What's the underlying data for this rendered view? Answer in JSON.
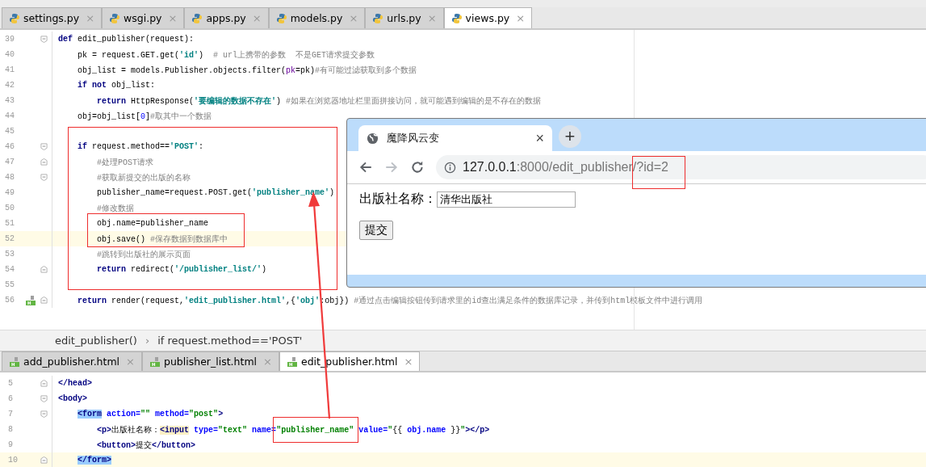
{
  "editor_tabs": [
    {
      "label": "settings.py",
      "close": "×",
      "selected": false
    },
    {
      "label": "wsgi.py",
      "close": "×",
      "selected": false
    },
    {
      "label": "apps.py",
      "close": "×",
      "selected": false
    },
    {
      "label": "models.py",
      "close": "×",
      "selected": false
    },
    {
      "label": "urls.py",
      "close": "×",
      "selected": false
    },
    {
      "label": "views.py",
      "close": "×",
      "selected": true
    }
  ],
  "python_editor": {
    "lines": [
      {
        "number": "39",
        "current": false,
        "fold_start": true,
        "fold_end": false,
        "tokens": [
          {
            "kind": "keyword",
            "text": "def"
          },
          {
            "kind": "plain",
            "text": " edit_publisher(request):"
          }
        ]
      },
      {
        "number": "40",
        "current": false,
        "fold_start": false,
        "fold_end": false,
        "tokens": [
          {
            "kind": "plain",
            "text": "    pk = request.GET.get("
          },
          {
            "kind": "string",
            "text": "'id'"
          },
          {
            "kind": "plain",
            "text": ")  "
          },
          {
            "kind": "comment",
            "text": "# url上携带的参数  不是GET请求提交参数"
          }
        ]
      },
      {
        "number": "41",
        "current": false,
        "fold_start": false,
        "fold_end": false,
        "tokens": [
          {
            "kind": "plain",
            "text": "    obj_list = models.Publisher.objects.filter("
          },
          {
            "kind": "param",
            "text": "pk"
          },
          {
            "kind": "plain",
            "text": "=pk)"
          },
          {
            "kind": "comment",
            "text": "#有可能过滤获取到多个数据"
          }
        ]
      },
      {
        "number": "42",
        "current": false,
        "fold_start": false,
        "fold_end": false,
        "tokens": [
          {
            "kind": "keyword",
            "text": "    if not"
          },
          {
            "kind": "plain",
            "text": " obj_list:"
          }
        ]
      },
      {
        "number": "43",
        "current": false,
        "fold_start": false,
        "fold_end": false,
        "tokens": [
          {
            "kind": "keyword",
            "text": "        return"
          },
          {
            "kind": "plain",
            "text": " HttpResponse("
          },
          {
            "kind": "string",
            "text": "'要编辑的数据不存在'"
          },
          {
            "kind": "plain",
            "text": ") "
          },
          {
            "kind": "comment",
            "text": "#如果在浏览器地址栏里面拼接访问，就可能遇到编辑的是不存在的数据"
          }
        ]
      },
      {
        "number": "44",
        "current": false,
        "fold_start": false,
        "fold_end": false,
        "tokens": [
          {
            "kind": "plain",
            "text": "    obj=obj_list["
          },
          {
            "kind": "number",
            "text": "0"
          },
          {
            "kind": "plain",
            "text": "]"
          },
          {
            "kind": "comment",
            "text": "#取其中一个数据"
          }
        ]
      },
      {
        "number": "45",
        "current": false,
        "fold_start": false,
        "fold_end": false
      },
      {
        "number": "46",
        "current": false,
        "fold_start": true,
        "fold_end": false,
        "tokens": [
          {
            "kind": "keyword",
            "text": "    if"
          },
          {
            "kind": "plain",
            "text": " request.method=="
          },
          {
            "kind": "string",
            "text": "'POST'"
          },
          {
            "kind": "plain",
            "text": ":"
          }
        ]
      },
      {
        "number": "47",
        "current": false,
        "fold_start": false,
        "fold_end": true,
        "tokens": [
          {
            "kind": "comment",
            "text": "        #处理POST请求"
          }
        ]
      },
      {
        "number": "48",
        "current": false,
        "fold_start": true,
        "fold_end": false,
        "tokens": [
          {
            "kind": "comment",
            "text": "        #获取新提交的出版的名称"
          }
        ]
      },
      {
        "number": "49",
        "current": false,
        "fold_start": false,
        "fold_end": false,
        "tokens": [
          {
            "kind": "plain",
            "text": "        publisher_name=request.POST.get("
          },
          {
            "kind": "string",
            "text": "'publisher_name'"
          },
          {
            "kind": "plain",
            "text": ")"
          }
        ]
      },
      {
        "number": "50",
        "current": false,
        "fold_start": false,
        "fold_end": false,
        "tokens": [
          {
            "kind": "comment",
            "text": "        #修改数据"
          }
        ]
      },
      {
        "number": "51",
        "current": false,
        "fold_start": false,
        "fold_end": false,
        "tokens": [
          {
            "kind": "plain",
            "text": "        obj.name=publisher_name"
          }
        ]
      },
      {
        "number": "52",
        "current": true,
        "fold_start": false,
        "fold_end": false,
        "tokens": [
          {
            "kind": "plain",
            "text": "        obj.save() "
          },
          {
            "kind": "comment",
            "text": "#保存数据到数据库中"
          }
        ]
      },
      {
        "number": "53",
        "current": false,
        "fold_start": false,
        "fold_end": false,
        "tokens": [
          {
            "kind": "comment",
            "text": "        #跳转到出版社的展示页面"
          }
        ]
      },
      {
        "number": "54",
        "current": false,
        "fold_start": false,
        "fold_end": true,
        "tokens": [
          {
            "kind": "keyword",
            "text": "        return"
          },
          {
            "kind": "plain",
            "text": " redirect("
          },
          {
            "kind": "string",
            "text": "'/publisher_list/'"
          },
          {
            "kind": "plain",
            "text": ")"
          }
        ]
      },
      {
        "number": "55",
        "current": false,
        "fold_start": false,
        "fold_end": false
      },
      {
        "number": "56",
        "current": false,
        "fold_start": false,
        "fold_end": true,
        "html_marker": true,
        "tokens": [
          {
            "kind": "keyword",
            "text": "    return"
          },
          {
            "kind": "plain",
            "text": " render(request,"
          },
          {
            "kind": "string",
            "text": "'edit_publisher.html'"
          },
          {
            "kind": "plain",
            "text": ",{"
          },
          {
            "kind": "string",
            "text": "'obj'"
          },
          {
            "kind": "plain",
            "text": ":obj}) "
          },
          {
            "kind": "comment",
            "text": "#通过点击编辑按钮传到请求里的id查出满足条件的数据库记录，并传到html模板文件中进行调用"
          }
        ]
      }
    ]
  },
  "breadcrumb": {
    "items": [
      "edit_publisher()",
      "if request.method=='POST'"
    ],
    "separator": "›"
  },
  "template_tabs": [
    {
      "label": "add_publisher.html",
      "close": "×",
      "selected": false
    },
    {
      "label": "publisher_list.html",
      "close": "×",
      "selected": false
    },
    {
      "label": "edit_publisher.html",
      "close": "×",
      "selected": true
    }
  ],
  "template_editor": {
    "lines": [
      {
        "number": "5",
        "current": false,
        "fold_start": false,
        "fold_end": true,
        "tokens": [
          {
            "kind": "tag",
            "text": "</head>"
          }
        ]
      },
      {
        "number": "6",
        "current": false,
        "fold_start": true,
        "fold_end": false,
        "tokens": [
          {
            "kind": "tag",
            "text": "<body>"
          }
        ]
      },
      {
        "number": "7",
        "current": false,
        "fold_start": true,
        "fold_end": false,
        "tokens": [
          {
            "kind": "tag-match",
            "text": "    <form"
          },
          {
            "kind": "attr",
            "text": " action="
          },
          {
            "kind": "value",
            "text": "\"\""
          },
          {
            "kind": "attr",
            "text": " method="
          },
          {
            "kind": "value",
            "text": "\"post\""
          },
          {
            "kind": "tag",
            "text": ">"
          }
        ]
      },
      {
        "number": "8",
        "current": false,
        "fold_start": false,
        "fold_end": false,
        "tokens": [
          {
            "kind": "tag",
            "text": "        <p>"
          },
          {
            "kind": "plain",
            "text": "出版社名称："
          },
          {
            "kind": "tag-input",
            "text": "<input"
          },
          {
            "kind": "attr",
            "text": " type="
          },
          {
            "kind": "value",
            "text": "\"text\""
          },
          {
            "kind": "attr",
            "text": " name="
          },
          {
            "kind": "value",
            "text": "\"publisher_name\""
          },
          {
            "kind": "attr",
            "text": " value="
          },
          {
            "kind": "value",
            "text": "\""
          },
          {
            "kind": "plain",
            "text": "{{ "
          },
          {
            "kind": "attr",
            "text": "obj.name"
          },
          {
            "kind": "plain",
            "text": " }}"
          },
          {
            "kind": "value",
            "text": "\""
          },
          {
            "kind": "tag",
            "text": "></p>"
          }
        ]
      },
      {
        "number": "9",
        "current": false,
        "fold_start": false,
        "fold_end": false,
        "tokens": [
          {
            "kind": "tag",
            "text": "        <button>"
          },
          {
            "kind": "plain",
            "text": "提交"
          },
          {
            "kind": "tag",
            "text": "</button>"
          }
        ]
      },
      {
        "number": "10",
        "current": true,
        "fold_start": false,
        "fold_end": true,
        "tokens": [
          {
            "kind": "tag-match",
            "text": "    </form>"
          }
        ]
      }
    ]
  },
  "browser": {
    "tab_title": "魔降风云变",
    "close": "×",
    "new_tab": "+",
    "address": {
      "host": "127.0.0.1",
      "path": ":8000/edit_publisher/?id=2"
    },
    "page": {
      "label": "出版社名称：",
      "input_value": "清华出版社",
      "button": "提交"
    }
  }
}
